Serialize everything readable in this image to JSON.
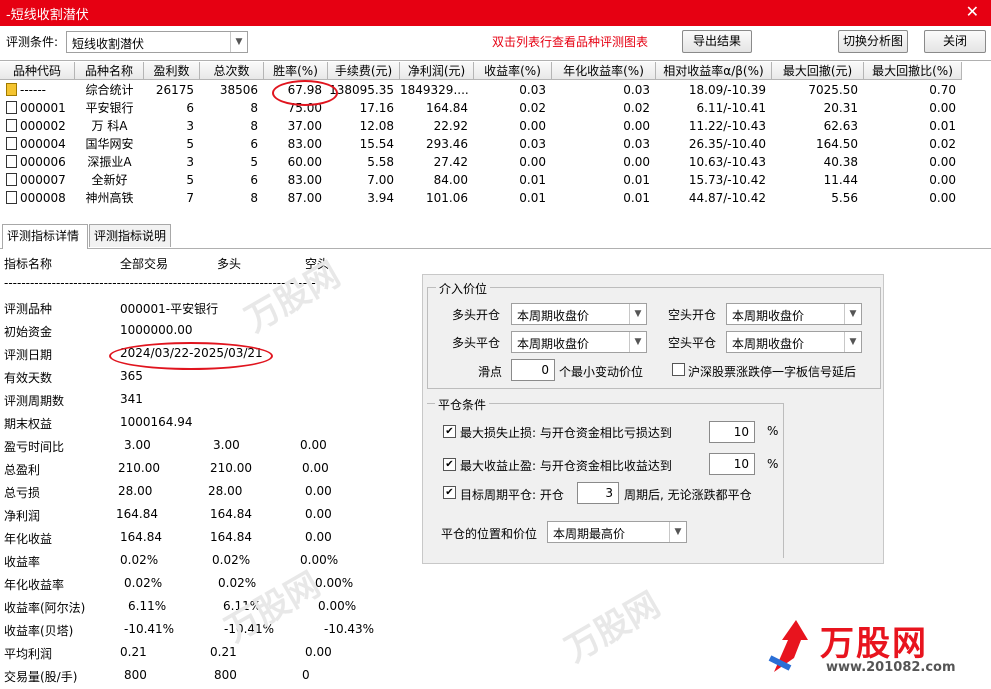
{
  "window": {
    "title": "-短线收割潜伏",
    "close_glyph": "✕"
  },
  "toolbar": {
    "condition_label": "评测条件:",
    "condition_value": "短线收割潜伏",
    "hint": "双击列表行查看品种评测图表",
    "export_label": "导出结果",
    "switch_label": "切换分析图",
    "close_label": "关闭"
  },
  "grid": {
    "columns": [
      "品种代码",
      "品种名称",
      "盈利数",
      "总次数",
      "胜率(%)",
      "手续费(元)",
      "净利润(元)",
      "收益率(%)",
      "年化收益率(%)",
      "相对收益率α/β(%)",
      "最大回撤(元)",
      "最大回撤比(%)"
    ],
    "rows": [
      {
        "code": "------",
        "name": "综合统计",
        "win": "26175",
        "total": "38506",
        "rate": "67.98",
        "fee": "138095.35",
        "profit": "1849329....",
        "ret": "0.03",
        "annual": "0.03",
        "alpha": "18.09/-10.39",
        "dd": "7025.50",
        "ddr": "0.70"
      },
      {
        "code": "000001",
        "name": "平安银行",
        "win": "6",
        "total": "8",
        "rate": "75.00",
        "fee": "17.16",
        "profit": "164.84",
        "ret": "0.02",
        "annual": "0.02",
        "alpha": "6.11/-10.41",
        "dd": "20.31",
        "ddr": "0.00"
      },
      {
        "code": "000002",
        "name": "万 科A",
        "win": "3",
        "total": "8",
        "rate": "37.00",
        "fee": "12.08",
        "profit": "22.92",
        "ret": "0.00",
        "annual": "0.00",
        "alpha": "11.22/-10.43",
        "dd": "62.63",
        "ddr": "0.01"
      },
      {
        "code": "000004",
        "name": "国华网安",
        "win": "5",
        "total": "6",
        "rate": "83.00",
        "fee": "15.54",
        "profit": "293.46",
        "ret": "0.03",
        "annual": "0.03",
        "alpha": "26.35/-10.40",
        "dd": "164.50",
        "ddr": "0.02"
      },
      {
        "code": "000006",
        "name": "深振业A",
        "win": "3",
        "total": "5",
        "rate": "60.00",
        "fee": "5.58",
        "profit": "27.42",
        "ret": "0.00",
        "annual": "0.00",
        "alpha": "10.63/-10.43",
        "dd": "40.38",
        "ddr": "0.00"
      },
      {
        "code": "000007",
        "name": "全新好",
        "win": "5",
        "total": "6",
        "rate": "83.00",
        "fee": "7.00",
        "profit": "84.00",
        "ret": "0.01",
        "annual": "0.01",
        "alpha": "15.73/-10.42",
        "dd": "11.44",
        "ddr": "0.00"
      },
      {
        "code": "000008",
        "name": "神州高铁",
        "win": "7",
        "total": "8",
        "rate": "87.00",
        "fee": "3.94",
        "profit": "101.06",
        "ret": "0.01",
        "annual": "0.01",
        "alpha": "44.87/-10.42",
        "dd": "5.56",
        "ddr": "0.00"
      }
    ]
  },
  "tabs": [
    "评测指标详情",
    "评测指标说明"
  ],
  "detail": {
    "headers": [
      "指标名称",
      "全部交易",
      "多头",
      "空头"
    ],
    "separator": "------------------------------------------------------------------------",
    "info": [
      {
        "label": "评测品种",
        "value": "000001-平安银行"
      },
      {
        "label": "初始资金",
        "value": "1000000.00"
      },
      {
        "label": "评测日期",
        "value": "2024/03/22-2025/03/21"
      },
      {
        "label": "有效天数",
        "value": "365"
      },
      {
        "label": "评测周期数",
        "value": "341"
      },
      {
        "label": "期末权益",
        "value": "1000164.94"
      }
    ],
    "metrics": [
      {
        "label": "盈亏时间比",
        "all": "3.00",
        "long": "3.00",
        "short": "0.00"
      },
      {
        "label": "总盈利",
        "all": "210.00",
        "long": "210.00",
        "short": "0.00"
      },
      {
        "label": "总亏损",
        "all": "28.00",
        "long": "28.00",
        "short": "0.00"
      },
      {
        "label": "净利润",
        "all": "164.84",
        "long": "164.84",
        "short": "0.00"
      },
      {
        "label": "年化收益",
        "all": "164.84",
        "long": "164.84",
        "short": "0.00"
      },
      {
        "label": "收益率",
        "all": "0.02%",
        "long": "0.02%",
        "short": "0.00%"
      },
      {
        "label": "年化收益率",
        "all": "0.02%",
        "long": "0.02%",
        "short": "0.00%"
      },
      {
        "label": "收益率(阿尔法)",
        "all": "6.11%",
        "long": "6.11%",
        "short": "0.00%"
      },
      {
        "label": "收益率(贝塔)",
        "all": "-10.41%",
        "long": "-10.41%",
        "short": "-10.43%"
      },
      {
        "label": "平均利润",
        "all": "0.21",
        "long": "0.21",
        "short": "0.00"
      },
      {
        "label": "交易量(股/手)",
        "all": "800",
        "long": "800",
        "short": "0"
      }
    ]
  },
  "entry": {
    "title": "介入价位",
    "long_open_label": "多头开仓",
    "long_open_value": "本周期收盘价",
    "short_open_label": "空头开仓",
    "short_open_value": "本周期收盘价",
    "long_close_label": "多头平仓",
    "long_close_value": "本周期收盘价",
    "short_close_label": "空头平仓",
    "short_close_value": "本周期收盘价",
    "slip_label": "滑点",
    "slip_value": "0",
    "slip_unit": "个最小变动价位",
    "delay_label": "沪深股票涨跌停一字板信号延后"
  },
  "exit": {
    "title": "平仓条件",
    "stoploss_label": "最大损失止损: 与开仓资金相比亏损达到",
    "stoploss_value": "10",
    "stoploss_unit": "%",
    "takeprofit_label": "最大收益止盈: 与开仓资金相比收益达到",
    "takeprofit_value": "10",
    "takeprofit_unit": "%",
    "period_label": "目标周期平仓: 开仓",
    "period_value": "3",
    "period_unit": "周期后, 无论涨跌都平仓",
    "position_label": "平仓的位置和价位",
    "position_value": "本周期最高价"
  },
  "logo": {
    "brand": "万股网",
    "url": "www.201082.com"
  },
  "colors": {
    "title_bar": "#e60012",
    "hint": "#e60012",
    "annotation": "#e0141e",
    "logo_red": "#e8141e"
  }
}
